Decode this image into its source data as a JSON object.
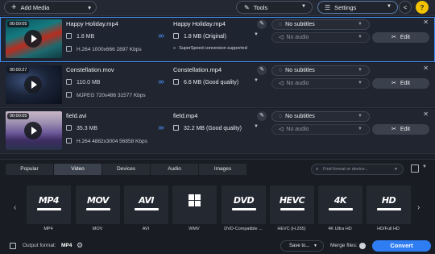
{
  "toolbar": {
    "add_media": "Add Media",
    "tools": "Tools",
    "settings": "Settings",
    "help": "?"
  },
  "files": [
    {
      "duration": "00:00:05",
      "name": "Happy Holiday.mp4",
      "size": "1.8 MB",
      "meta": "H.264 1000x666 2897 Kbps",
      "output_name": "Happy Holiday.mp4",
      "output_size": "1.8 MB (Original)",
      "note": "SuperSpeed conversion supported",
      "subtitles": "No subtitles",
      "audio": "No audio",
      "edit": "Edit"
    },
    {
      "duration": "00:00:27",
      "name": "Constellation.mov",
      "size": "110.0 MB",
      "meta": "MJPEG 720x486 31577 Kbps",
      "output_name": "Constellation.mp4",
      "output_size": "6.6 MB (Good quality)",
      "subtitles": "No subtitles",
      "audio": "No audio",
      "edit": "Edit"
    },
    {
      "duration": "00:00:05",
      "name": "field.avi",
      "size": "35.3 MB",
      "meta": "H.264 4882x3004 56858 Kbps",
      "output_name": "field.mp4",
      "output_size": "32.2 MB (Good quality)",
      "subtitles": "No subtitles",
      "audio": "No audio",
      "edit": "Edit"
    }
  ],
  "panel": {
    "tabs": [
      "Popular",
      "Video",
      "Devices",
      "Audio",
      "Images"
    ],
    "active_tab": "Video",
    "find_placeholder": "Find format or device...",
    "formats": [
      {
        "logo": "MP4",
        "label": "MP4"
      },
      {
        "logo": "MOV",
        "label": "MOV"
      },
      {
        "logo": "AVI",
        "label": "AVI"
      },
      {
        "logo": "",
        "label": "WMV"
      },
      {
        "logo": "DVD",
        "label": "DVD-Compatible ..."
      },
      {
        "logo": "HEVC",
        "label": "HEVC (H.265)"
      },
      {
        "logo": "4K",
        "label": "4K Ultra HD"
      },
      {
        "logo": "HD",
        "label": "HD/Full HD"
      }
    ]
  },
  "footer": {
    "output_format_label": "Output format:",
    "output_format_value": "MP4",
    "save_to": "Save to...",
    "merge_files": "Merge files:",
    "convert": "Convert"
  },
  "colors": {
    "accent": "#2f7df2",
    "help": "#f2c200",
    "background": "#1b1f27"
  },
  "icons": [
    "plus-icon",
    "tools-icon",
    "settings-icon",
    "share-icon",
    "help-icon",
    "play-icon",
    "file-icon",
    "arrows-icon",
    "pencil-icon",
    "subtitles-icon",
    "audio-icon",
    "scissors-icon",
    "close-icon",
    "search-icon",
    "gear-icon",
    "windows-icon"
  ]
}
